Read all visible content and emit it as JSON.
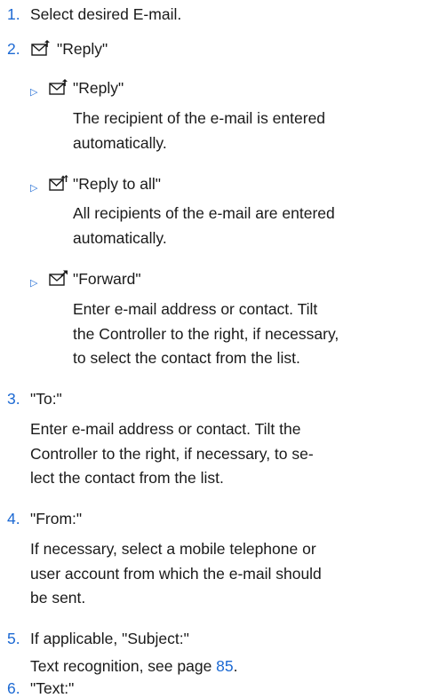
{
  "steps": [
    {
      "num": "1.",
      "text": "Select desired E-mail."
    },
    {
      "num": "2.",
      "icon": "reply-mail-icon",
      "text": "\"Reply\""
    },
    {
      "num": "3.",
      "text": "\"To:\"",
      "desc": [
        "Enter e-mail address or contact. Tilt the",
        "Controller to the right, if necessary, to se-",
        "lect the contact from the list."
      ]
    },
    {
      "num": "4.",
      "text": "\"From:\"",
      "desc": [
        "If necessary, select a mobile telephone or",
        "user account from which the e-mail should",
        "be sent."
      ]
    },
    {
      "num": "5.",
      "text": "If applicable, \"Subject:\"",
      "desc_prefix": "Text recognition, see page ",
      "desc_link": "85",
      "desc_suffix": "."
    },
    {
      "num": "6.",
      "text": "\"Text:\""
    }
  ],
  "suboptions": [
    {
      "marker": "▷",
      "icon": "reply-mail-icon",
      "label": "\"Reply\"",
      "desc": [
        "The recipient of the e-mail is entered",
        "automatically."
      ]
    },
    {
      "marker": "▷",
      "icon": "reply-all-mail-icon",
      "label": "\"Reply to all\"",
      "desc": [
        "All recipients of the e-mail are entered",
        "automatically."
      ]
    },
    {
      "marker": "▷",
      "icon": "forward-mail-icon",
      "label": "\"Forward\"",
      "desc": [
        "Enter e-mail address or contact. Tilt",
        "the Controller to the right, if necessary,",
        "to select the contact from the list."
      ]
    }
  ]
}
